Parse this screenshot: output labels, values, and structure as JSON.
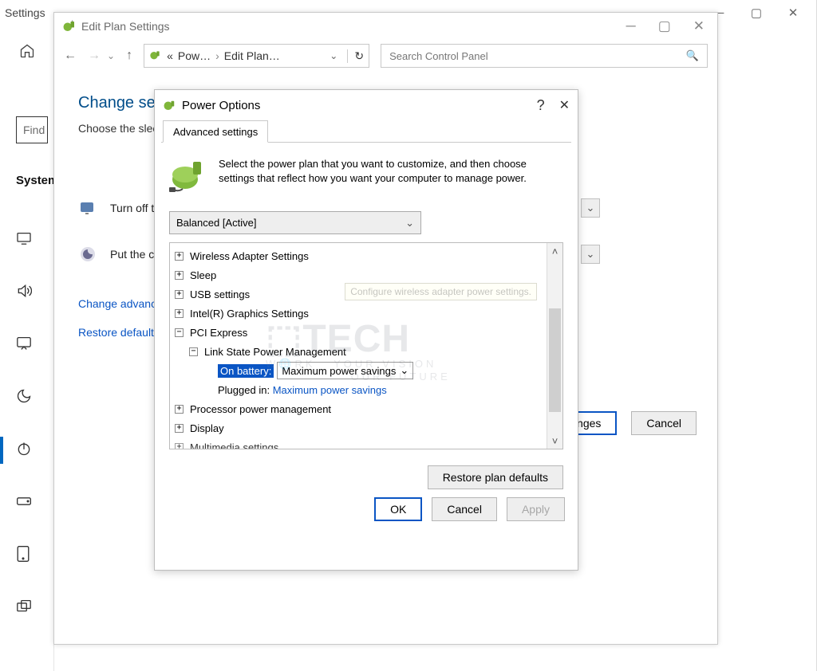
{
  "settings": {
    "title": "Settings",
    "find_placeholder": "Find",
    "system_label": "System",
    "multitasking_label": "Multitasking"
  },
  "editplan": {
    "title": "Edit Plan Settings",
    "breadcrumb": {
      "p1": "Pow…",
      "p2": "Edit Plan…"
    },
    "search_placeholder": "Search Control Panel",
    "heading": "Change settings",
    "sub": "Choose the sleep",
    "row1": "Turn off the",
    "row2": "Put the computer",
    "link_advanced": "Change advanced",
    "link_restore": "Restore default",
    "save_btn": "Save changes",
    "cancel_btn": "Cancel"
  },
  "po": {
    "title": "Power Options",
    "tab": "Advanced settings",
    "hint": "Select the power plan that you want to customize, and then choose settings that reflect how you want your computer to manage power.",
    "plan_label": "Balanced [Active]",
    "tooltip": "Configure wireless adapter power settings.",
    "tree": {
      "wireless": "Wireless Adapter Settings",
      "sleep": "Sleep",
      "usb": "USB settings",
      "intel": "Intel(R) Graphics Settings",
      "pci": "PCI Express",
      "link_state": "Link State Power Management",
      "on_battery_label": "On battery:",
      "on_battery_value": "Maximum power savings",
      "plugged_in_label": "Plugged in:",
      "plugged_in_value": "Maximum power savings",
      "processor": "Processor power management",
      "display": "Display",
      "multimedia": "Multimedia settings"
    },
    "restore_btn": "Restore plan defaults",
    "ok_btn": "OK",
    "cancel_btn": "Cancel",
    "apply_btn": "Apply"
  }
}
